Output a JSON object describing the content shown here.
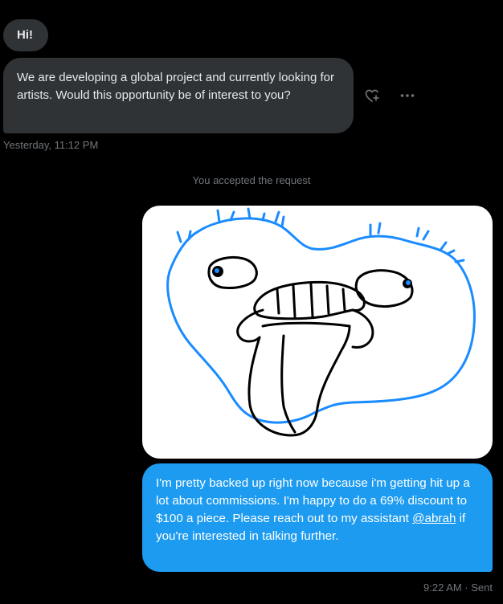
{
  "conversation": {
    "incoming": [
      {
        "text": "Hi!"
      },
      {
        "text": "We are developing a global project and currently looking for artists. Would this opportunity be of interest to you?"
      }
    ],
    "incoming_timestamp": "Yesterday, 11:12 PM",
    "system_note": "You accepted the request",
    "outgoing_image": {
      "icon": "drawing-image"
    },
    "outgoing": {
      "text_before": "I'm pretty backed up right now because i'm getting hit up a lot about commissions. I'm happy to do a 69% discount to $100 a piece. Please reach out to my assistant ",
      "mention": "@abrah",
      "text_after": " if you're interested in talking further."
    },
    "outgoing_status": "9:22 AM · Sent"
  },
  "actions": {
    "react_icon": "add-reaction-icon",
    "more_icon": "more-icon"
  },
  "colors": {
    "background": "#000000",
    "incoming_bubble": "#2f3336",
    "outgoing_bubble": "#1d9bf0",
    "muted_text": "#71767b",
    "drawing_stroke": "#1a8cff"
  }
}
